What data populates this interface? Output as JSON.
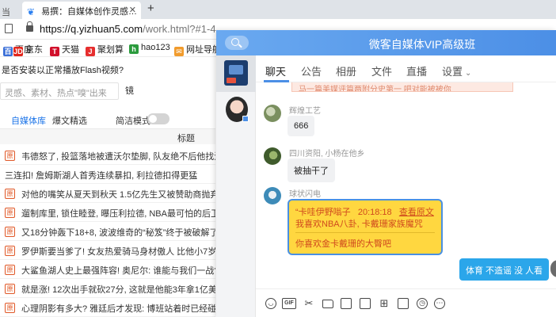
{
  "browser": {
    "prev_tab_title": "当",
    "active_tab_title": "易撰：自媒体创作灵感…",
    "active_tab_icon": "易撰-favicon-icon",
    "url_host": "https://q.yizhuan5.com",
    "url_rest": "/work.html?#1-4",
    "bookmarks": [
      {
        "label": "百度",
        "icon": "baidu-icon",
        "color": "#3a6fd8"
      },
      {
        "label": "京东",
        "icon": "jd-icon",
        "color": "#e1251b"
      },
      {
        "label": "天猫",
        "icon": "tmall-icon",
        "color": "#d1102b"
      },
      {
        "label": "聚划算",
        "icon": "juhuasuan-icon",
        "color": "#e62e2e"
      },
      {
        "label": "hao123",
        "icon": "hao123-icon",
        "color": "#2b9b3d"
      },
      {
        "label": "网址导航",
        "icon": "nav-icon",
        "color": "#f19b2c"
      }
    ]
  },
  "webpage": {
    "flash_prompt": "是否安装以正常播放Flash视频?",
    "search_placeholder": "灵感、素材、热点\"嗅\"出来",
    "mirror_label": "镜",
    "tabs": [
      "自媒体库",
      "爆文精选"
    ],
    "plain_mode_label": "简洁模式",
    "column_header": "标题",
    "headlines": [
      {
        "text": "韦德怒了, 投篮落地被遭沃尔垫脚, 队友绝不后他找沃尔理论",
        "icon": true
      },
      {
        "text": "三连扣! 詹姆斯湖人首秀连续暴扣, 利拉德扣得更猛",
        "icon": false
      },
      {
        "text": "对他的嘴笑从夏天到秋天 1.5亿先生又被赞助商抛弃 经纪人",
        "icon": true
      },
      {
        "text": "遛制库里, 锁住睦登, 曝压利拉德, NBA最可怕的后卫终结者",
        "icon": true
      },
      {
        "text": "又18分钟轰下18+8, 波波维奇的“秘笈”终于被破解了",
        "icon": true
      },
      {
        "text": "罗伊斯要当爹了! 女友热爱骑马身材傲人 比他小7岁身高1米",
        "icon": true
      },
      {
        "text": "大鲨鱼湖人史上最强阵容! 奥尼尔: 谁能与我们一战?",
        "icon": true
      },
      {
        "text": "就是涨! 12次出手就砍27分, 这就是他能3年拿1亿美元的真",
        "icon": true
      },
      {
        "text": "心理阴影有多大? 雅廷后才发现: 博班站着时已经碰框…",
        "icon": true
      }
    ]
  },
  "chat": {
    "title": "微客自媒体VIP高级班",
    "tabs": [
      "聊天",
      "公告",
      "相册",
      "文件",
      "直播",
      "设置"
    ],
    "announcement": "马一篇美媒评篇两附分史第一 吧对能被被你",
    "messages": [
      {
        "sender": "辉煌工艺",
        "text": "666"
      },
      {
        "sender": "四川资阳, 小杨在他乡",
        "text": "被抽干了"
      }
    ],
    "quote": {
      "sender": "球状闪电",
      "header": "“卡哇伊野嗡子",
      "time": "20:18:18",
      "link": "查看原文",
      "quoted": "我喜欢NBA八卦, 卡戴珊家族魔咒",
      "reply": "你喜欢金卡戴珊的大臀吧"
    },
    "outgoing": "体育 不造谣 没 人看",
    "toolbar_icons": [
      "emoji-icon",
      "gif-icon",
      "scissors-icon",
      "folder-icon",
      "image-folder-icon",
      "calendar-icon",
      "gift-icon",
      "video-icon",
      "clock-icon",
      "more-icon"
    ]
  }
}
